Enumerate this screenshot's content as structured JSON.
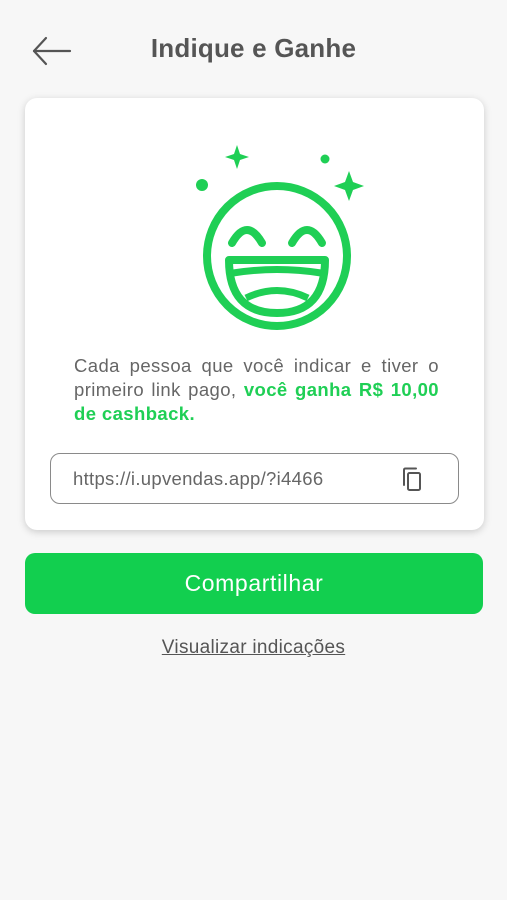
{
  "header": {
    "title": "Indique e Ganhe",
    "back_icon": "arrow-left-icon"
  },
  "card": {
    "illustration_icon": "laughing-face-icon",
    "accent_color": "#1fcf55",
    "description_text": "Cada pessoa que você indicar e tiver o primeiro link pago, ",
    "description_highlight": "você ganha R$ 10,00 de cashback.",
    "referral_link": "https://i.upvendas.app/?i4466",
    "copy_icon": "copy-icon"
  },
  "actions": {
    "share_label": "Compartilhar",
    "view_referrals_label": "Visualizar indicações"
  }
}
